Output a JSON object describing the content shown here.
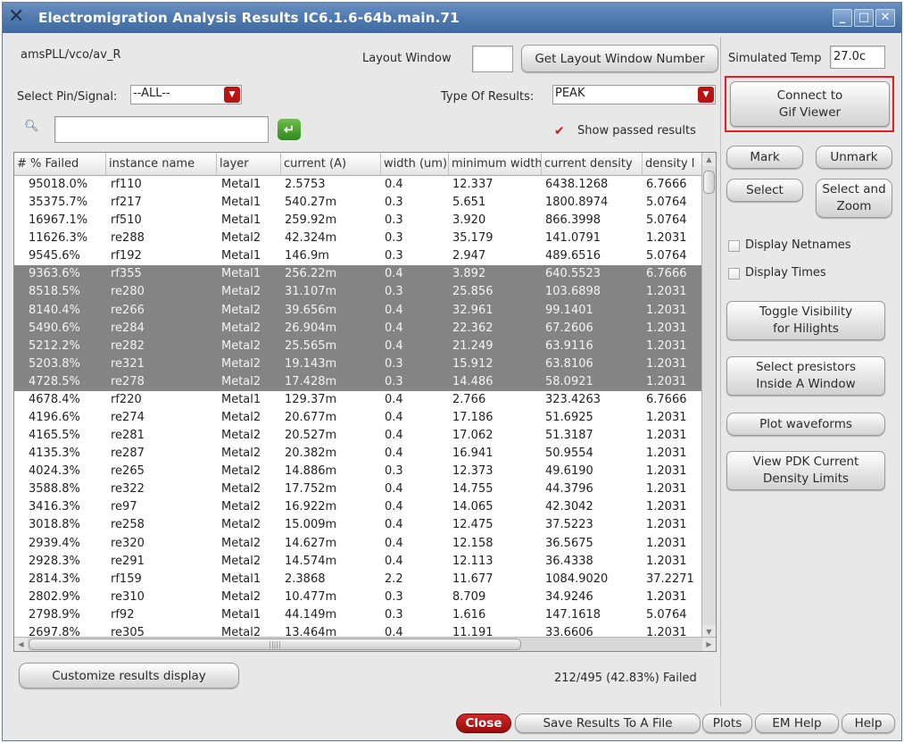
{
  "window": {
    "title": "Electromigration Analysis Results IC6.1.6-64b.main.71"
  },
  "header": {
    "cell_path": "amsPLL/vco/av_R",
    "layout_window_label": "Layout Window",
    "layout_window_value": "",
    "get_layout_button": "Get Layout Window Number",
    "sim_temp_label": "Simulated Temp",
    "sim_temp_value": "27.0c"
  },
  "filters": {
    "select_pin_label": "Select Pin/Signal:",
    "select_pin_value": "--ALL--",
    "type_label": "Type Of Results:",
    "type_value": "PEAK",
    "search_value": "",
    "show_passed_label": "Show passed results",
    "show_passed_checked": true
  },
  "table": {
    "columns": [
      "# % Failed",
      "instance name",
      "layer",
      "current (A)",
      "width (um)",
      "minimum width",
      "current density",
      "density l"
    ],
    "rows": [
      {
        "c": [
          "95018.0%",
          "rf110",
          "Metal1",
          "2.5753",
          "0.4",
          "12.337",
          "6438.1268",
          "6.7666"
        ],
        "sel": false
      },
      {
        "c": [
          "35375.7%",
          "rf217",
          "Metal1",
          "540.27m",
          "0.3",
          "5.651",
          "1800.8974",
          "5.0764"
        ],
        "sel": false
      },
      {
        "c": [
          "16967.1%",
          "rf510",
          "Metal1",
          "259.92m",
          "0.3",
          "3.920",
          "866.3998",
          "5.0764"
        ],
        "sel": false
      },
      {
        "c": [
          "11626.3%",
          "re288",
          "Metal2",
          "42.324m",
          "0.3",
          "35.179",
          "141.0791",
          "1.2031"
        ],
        "sel": false
      },
      {
        "c": [
          "9545.6%",
          "rf192",
          "Metal1",
          "146.9m",
          "0.3",
          "2.947",
          "489.6516",
          "5.0764"
        ],
        "sel": false
      },
      {
        "c": [
          "9363.6%",
          "rf355",
          "Metal1",
          "256.22m",
          "0.4",
          "3.892",
          "640.5523",
          "6.7666"
        ],
        "sel": true
      },
      {
        "c": [
          "8518.5%",
          "re280",
          "Metal2",
          "31.107m",
          "0.3",
          "25.856",
          "103.6898",
          "1.2031"
        ],
        "sel": true
      },
      {
        "c": [
          "8140.4%",
          "re266",
          "Metal2",
          "39.656m",
          "0.4",
          "32.961",
          "99.1401",
          "1.2031"
        ],
        "sel": true
      },
      {
        "c": [
          "5490.6%",
          "re284",
          "Metal2",
          "26.904m",
          "0.4",
          "22.362",
          "67.2606",
          "1.2031"
        ],
        "sel": true
      },
      {
        "c": [
          "5212.2%",
          "re282",
          "Metal2",
          "25.565m",
          "0.4",
          "21.249",
          "63.9116",
          "1.2031"
        ],
        "sel": true
      },
      {
        "c": [
          "5203.8%",
          "re321",
          "Metal2",
          "19.143m",
          "0.3",
          "15.912",
          "63.8106",
          "1.2031"
        ],
        "sel": true
      },
      {
        "c": [
          "4728.5%",
          "re278",
          "Metal2",
          "17.428m",
          "0.3",
          "14.486",
          "58.0921",
          "1.2031"
        ],
        "sel": true
      },
      {
        "c": [
          "4678.4%",
          "rf220",
          "Metal1",
          "129.37m",
          "0.4",
          "2.766",
          "323.4263",
          "6.7666"
        ],
        "sel": false
      },
      {
        "c": [
          "4196.6%",
          "re274",
          "Metal2",
          "20.677m",
          "0.4",
          "17.186",
          "51.6925",
          "1.2031"
        ],
        "sel": false
      },
      {
        "c": [
          "4165.5%",
          "re281",
          "Metal2",
          "20.527m",
          "0.4",
          "17.062",
          "51.3187",
          "1.2031"
        ],
        "sel": false
      },
      {
        "c": [
          "4135.3%",
          "re287",
          "Metal2",
          "20.382m",
          "0.4",
          "16.941",
          "50.9554",
          "1.2031"
        ],
        "sel": false
      },
      {
        "c": [
          "4024.3%",
          "re265",
          "Metal2",
          "14.886m",
          "0.3",
          "12.373",
          "49.6190",
          "1.2031"
        ],
        "sel": false
      },
      {
        "c": [
          "3588.8%",
          "re322",
          "Metal2",
          "17.752m",
          "0.4",
          "14.755",
          "44.3796",
          "1.2031"
        ],
        "sel": false
      },
      {
        "c": [
          "3416.3%",
          "re97",
          "Metal2",
          "16.922m",
          "0.4",
          "14.065",
          "42.3042",
          "1.2031"
        ],
        "sel": false
      },
      {
        "c": [
          "3018.8%",
          "re258",
          "Metal2",
          "15.009m",
          "0.4",
          "12.475",
          "37.5223",
          "1.2031"
        ],
        "sel": false
      },
      {
        "c": [
          "2939.4%",
          "re320",
          "Metal2",
          "14.627m",
          "0.4",
          "12.158",
          "36.5675",
          "1.2031"
        ],
        "sel": false
      },
      {
        "c": [
          "2928.3%",
          "re291",
          "Metal2",
          "14.574m",
          "0.4",
          "12.113",
          "36.4338",
          "1.2031"
        ],
        "sel": false
      },
      {
        "c": [
          "2814.3%",
          "rf159",
          "Metal1",
          "2.3868",
          "2.2",
          "11.677",
          "1084.9020",
          "37.2271"
        ],
        "sel": false
      },
      {
        "c": [
          "2802.9%",
          "re310",
          "Metal2",
          "10.477m",
          "0.3",
          "8.709",
          "34.9246",
          "1.2031"
        ],
        "sel": false
      },
      {
        "c": [
          "2798.9%",
          "rf92",
          "Metal1",
          "44.149m",
          "0.3",
          "1.616",
          "147.1618",
          "5.0764"
        ],
        "sel": false
      },
      {
        "c": [
          "2697.8%",
          "re305",
          "Metal2",
          "13.464m",
          "0.4",
          "11.191",
          "33.6606",
          "1.2031"
        ],
        "sel": false
      }
    ]
  },
  "footer": {
    "customize_button": "Customize results display",
    "failed_summary": "212/495 (42.83%) Failed",
    "close_button": "Close",
    "save_button": "Save Results To A File",
    "plots_button": "Plots",
    "em_help_button": "EM Help",
    "help_button": "Help"
  },
  "side": {
    "connect_line1": "Connect to",
    "connect_line2": "Gif Viewer",
    "mark": "Mark",
    "unmark": "Unmark",
    "select": "Select",
    "select_zoom_line1": "Select and",
    "select_zoom_line2": "Zoom",
    "display_netnames": "Display Netnames",
    "display_times": "Display Times",
    "toggle_line1": "Toggle Visibility",
    "toggle_line2": "for Hilights",
    "presistors_line1": "Select presistors",
    "presistors_line2": "Inside A Window",
    "plot_waveforms": "Plot waveforms",
    "pdk_line1": "View PDK Current",
    "pdk_line2": "Density Limits"
  },
  "colors": {
    "highlight_box": "#e02020",
    "selected_row": "#848484",
    "close_button": "#b81414",
    "title_bar": "#4e79ae"
  }
}
